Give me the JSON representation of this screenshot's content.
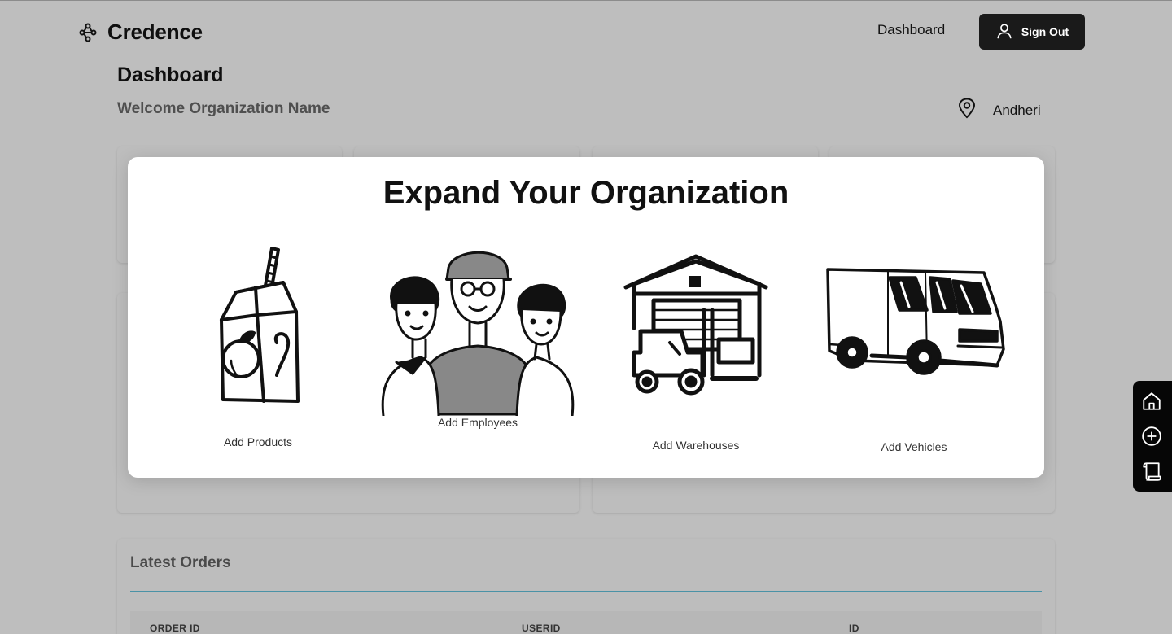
{
  "header": {
    "brand": "Credence",
    "nav_dashboard": "Dashboard",
    "sign_out": "Sign Out"
  },
  "page": {
    "title": "Dashboard",
    "welcome": "Welcome Organization Name",
    "location": "Andheri"
  },
  "modal": {
    "title": "Expand Your Organization",
    "options": [
      {
        "label": "Add Products",
        "icon": "juice-carton-illustration"
      },
      {
        "label": "Add Employees",
        "icon": "employees-group-illustration"
      },
      {
        "label": "Add Warehouses",
        "icon": "warehouse-forklift-illustration"
      },
      {
        "label": "Add Vehicles",
        "icon": "delivery-van-illustration"
      }
    ]
  },
  "orders": {
    "title": "Latest Orders",
    "columns": [
      "ORDER ID",
      "USERID",
      "ID"
    ]
  },
  "dock": {
    "items": [
      "home-icon",
      "add-circle-icon",
      "scroll-icon"
    ]
  },
  "colors": {
    "overlay_bg": "#bebebe",
    "button_dark": "#1a1a1a",
    "modal_bg": "#ffffff",
    "divider": "#4a92a6"
  }
}
